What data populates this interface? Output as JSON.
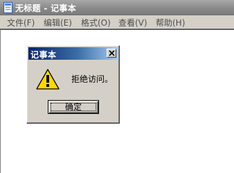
{
  "window": {
    "title": "无标题 - 记事本",
    "icon": "notepad-icon"
  },
  "menu": [
    {
      "label": "文件(F)"
    },
    {
      "label": "编辑(E)"
    },
    {
      "label": "格式(O)"
    },
    {
      "label": "查看(V)"
    },
    {
      "label": "帮助(H)"
    }
  ],
  "dialog": {
    "title": "记事本",
    "message": "拒绝访问。",
    "icon": "warning-icon",
    "ok_label": "确定"
  },
  "colors": {
    "inactive_titlebar": "#8a8a8a",
    "dialog_titlebar": "#0a246a",
    "warning_yellow": "#ffd800"
  }
}
